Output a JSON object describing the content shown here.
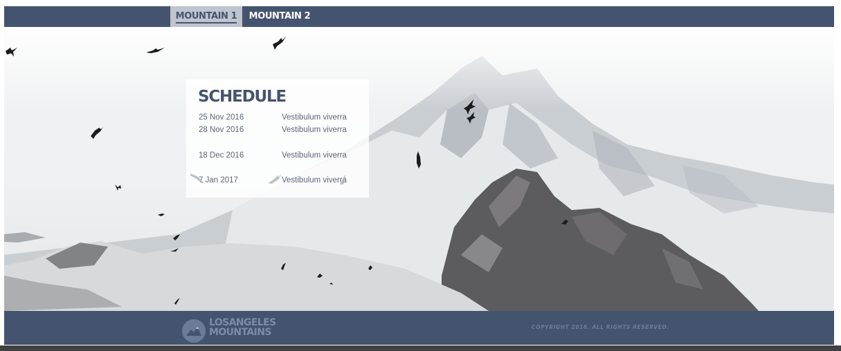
{
  "nav": {
    "tabs": [
      {
        "label": "MOUNTAIN 1",
        "active": true
      },
      {
        "label": "MOUNTAIN 2",
        "active": false
      }
    ]
  },
  "hero": {
    "image_subject": "snowy mountain with flying birds"
  },
  "schedule": {
    "title": "SCHEDULE",
    "rows": [
      {
        "date": "25 Nov 2016",
        "event": "Vestibulum viverra"
      },
      {
        "date": "28 Nov 2016",
        "event": "Vestibulum viverra"
      },
      {
        "date": "18 Dec 2016",
        "event": "Vestibulum viverra"
      },
      {
        "date": "7 Jan 2017",
        "event": "Vestibulum viverra"
      }
    ]
  },
  "footer": {
    "logo_line1": "LOSANGELES",
    "logo_line2": "MOUNTAINS",
    "copyright": "COPYRIGHT 2016. ALL RIGHTS RESERVED."
  },
  "colors": {
    "nav_bg": "#44546f",
    "active_tab_bg": "#bfc5cf",
    "footer_bg": "#44546f",
    "title": "#44546f"
  }
}
